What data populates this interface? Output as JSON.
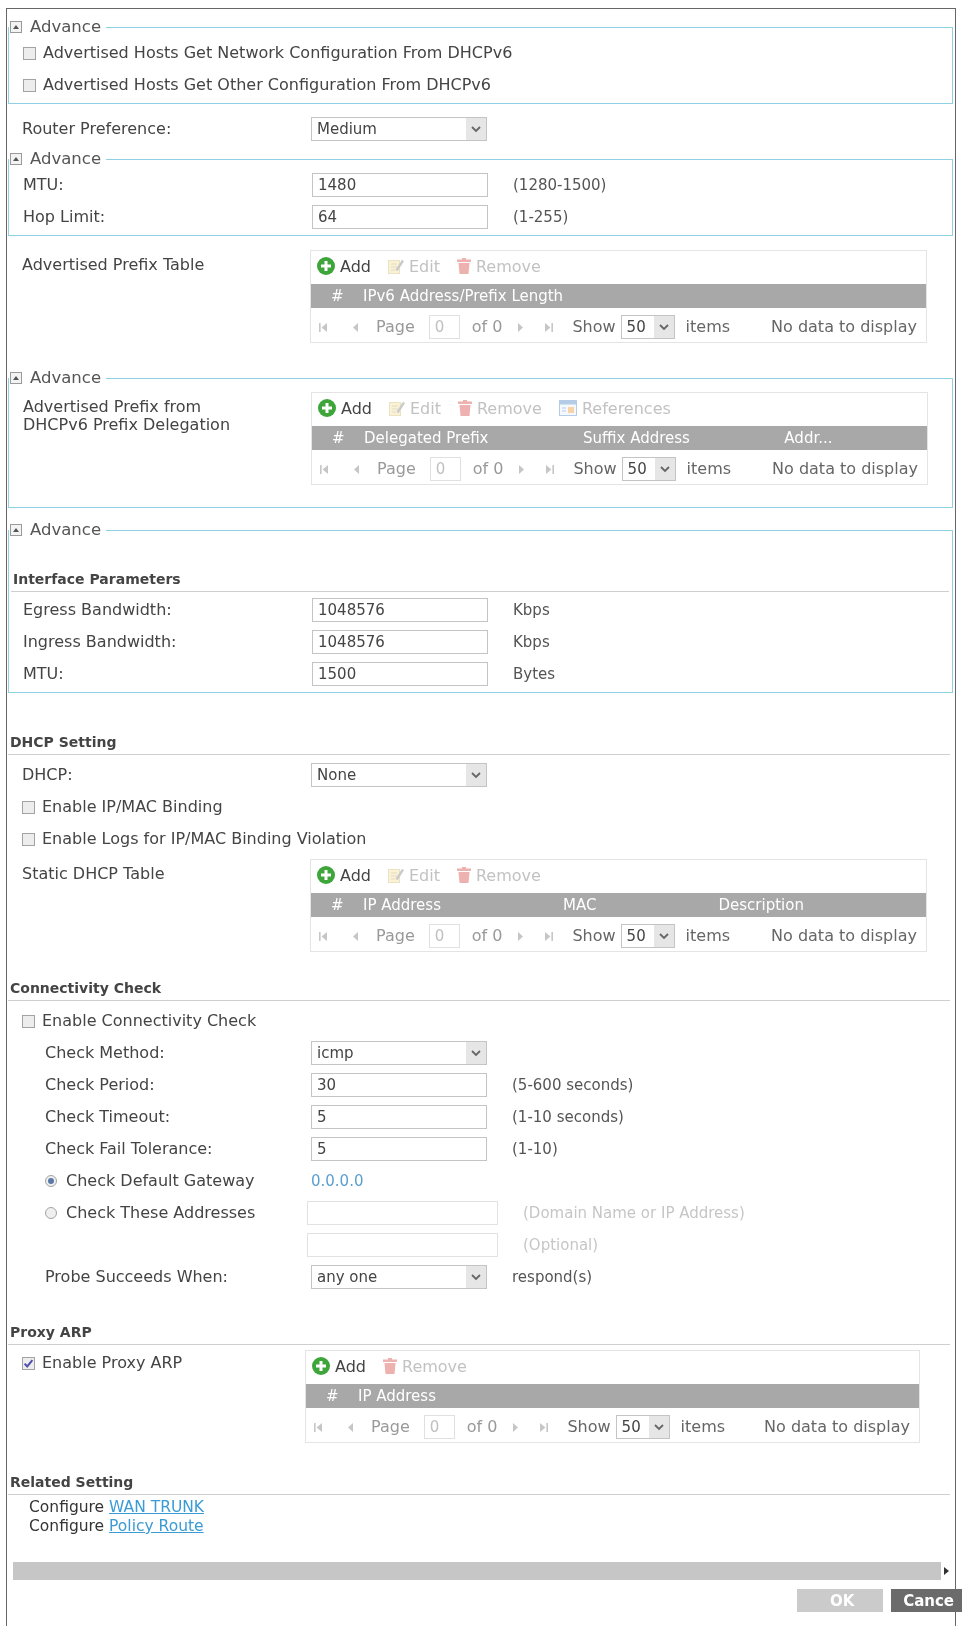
{
  "blocks": [
    {
      "kind": "advance",
      "legend": "Advance",
      "expanded": true,
      "rows": [
        {
          "kind": "checkbox",
          "label": "Advertised Hosts Get Network Configuration From DHCPv6",
          "checked": false
        },
        {
          "kind": "checkbox",
          "label": "Advertised Hosts Get Other Configuration From DHCPv6",
          "checked": false
        }
      ]
    },
    {
      "kind": "select",
      "label": "Router Preference:",
      "value": "Medium"
    },
    {
      "kind": "advance",
      "legend": "Advance",
      "expanded": true,
      "rows": [
        {
          "kind": "input",
          "label": "MTU:",
          "value": "1480",
          "hint": "(1280-1500)",
          "disabled": false
        },
        {
          "kind": "input",
          "label": "Hop Limit:",
          "value": "64",
          "hint": "(1-255)",
          "disabled": false
        }
      ]
    },
    {
      "kind": "table",
      "label": "Advertised Prefix Table",
      "toolbar": [
        {
          "kind": "add",
          "label": "Add",
          "disabled": false
        },
        {
          "kind": "edit",
          "label": "Edit",
          "disabled": true
        },
        {
          "kind": "remove",
          "label": "Remove",
          "disabled": true
        }
      ],
      "columns": [
        "#",
        "IPv6 Address/Prefix Length"
      ],
      "pager": {
        "page_label": "Page",
        "page": "0",
        "total": "of 0",
        "show": "Show",
        "per_page": "50",
        "unit": "items",
        "empty": "No data to display"
      }
    },
    {
      "kind": "advance",
      "legend": "Advance",
      "expanded": true,
      "rows": [
        {
          "kind": "table",
          "label": "Advertised Prefix from DHCPv6 Prefix Delegation",
          "toolbar": [
            {
              "kind": "add",
              "label": "Add",
              "disabled": false
            },
            {
              "kind": "edit",
              "label": "Edit",
              "disabled": true
            },
            {
              "kind": "remove",
              "label": "Remove",
              "disabled": true
            },
            {
              "kind": "references",
              "label": "References",
              "disabled": true
            }
          ],
          "columns": [
            "#",
            "Delegated Prefix",
            "Suffix Address",
            "Addr..."
          ],
          "pager": {
            "page_label": "Page",
            "page": "0",
            "total": "of 0",
            "show": "Show",
            "per_page": "50",
            "unit": "items",
            "empty": "No data to display"
          }
        }
      ]
    },
    {
      "kind": "advance",
      "legend": "Advance",
      "expanded": true,
      "rows": [
        {
          "kind": "heading",
          "text": "Interface Parameters"
        },
        {
          "kind": "input",
          "label": "Egress Bandwidth:",
          "value": "1048576",
          "hint": "Kbps",
          "disabled": false
        },
        {
          "kind": "input",
          "label": "Ingress Bandwidth:",
          "value": "1048576",
          "hint": "Kbps",
          "disabled": false
        },
        {
          "kind": "input",
          "label": "MTU:",
          "value": "1500",
          "hint": "Bytes",
          "disabled": false
        }
      ]
    },
    {
      "kind": "heading",
      "text": "DHCP Setting"
    },
    {
      "kind": "select",
      "label": "DHCP:",
      "value": "None"
    },
    {
      "kind": "checkbox",
      "label": "Enable IP/MAC Binding",
      "checked": false
    },
    {
      "kind": "checkbox",
      "label": "Enable Logs for IP/MAC Binding Violation",
      "checked": false
    },
    {
      "kind": "table",
      "label": "Static DHCP Table",
      "toolbar": [
        {
          "kind": "add",
          "label": "Add",
          "disabled": false
        },
        {
          "kind": "edit",
          "label": "Edit",
          "disabled": true
        },
        {
          "kind": "remove",
          "label": "Remove",
          "disabled": true
        }
      ],
      "columns": [
        "#",
        "IP Address",
        "MAC",
        "Description"
      ],
      "pager": {
        "page_label": "Page",
        "page": "0",
        "total": "of 0",
        "show": "Show",
        "per_page": "50",
        "unit": "items",
        "empty": "No data to display"
      }
    },
    {
      "kind": "heading",
      "text": "Connectivity Check"
    },
    {
      "kind": "checkbox",
      "label": "Enable Connectivity Check",
      "checked": false,
      "children": [
        {
          "kind": "select",
          "label": "Check Method:",
          "value": "icmp"
        },
        {
          "kind": "input",
          "label": "Check Period:",
          "value": "30",
          "hint": "(5-600 seconds)",
          "disabled": false
        },
        {
          "kind": "input",
          "label": "Check Timeout:",
          "value": "5",
          "hint": "(1-10 seconds)",
          "disabled": false
        },
        {
          "kind": "input",
          "label": "Check Fail Tolerance:",
          "value": "5",
          "hint": "(1-10)",
          "disabled": false
        },
        {
          "kind": "radio",
          "label": "Check Default Gateway",
          "selected": true,
          "value": "0.0.0.0"
        },
        {
          "kind": "radio",
          "label": "Check These Addresses",
          "selected": false,
          "field": {
            "disabled": true,
            "hint": "(Domain Name or IP Address)"
          }
        },
        {
          "kind": "input",
          "hint": "(Optional)",
          "disabled": true
        },
        {
          "kind": "select",
          "label": "Probe Succeeds When:",
          "value": "any one",
          "hint": "respond(s)"
        }
      ]
    },
    {
      "kind": "heading",
      "text": "Proxy ARP"
    },
    {
      "kind": "table",
      "checkbox": {
        "label": "Enable Proxy ARP",
        "checked": true
      },
      "toolbar": [
        {
          "kind": "add",
          "label": "Add",
          "disabled": false
        },
        {
          "kind": "remove",
          "label": "Remove",
          "disabled": true
        }
      ],
      "columns": [
        "#",
        "IP Address"
      ],
      "pager": {
        "page_label": "Page",
        "page": "0",
        "total": "of 0",
        "show": "Show",
        "per_page": "50",
        "unit": "items",
        "empty": "No data to display"
      }
    },
    {
      "kind": "heading",
      "text": "Related Setting"
    },
    {
      "kind": "links",
      "items": [
        {
          "text": "Configure",
          "link": "WAN TRUNK"
        },
        {
          "text": "Configure",
          "link": "Policy Route"
        }
      ]
    }
  ],
  "buttons": [
    {
      "label": "OK",
      "disabled": true
    },
    {
      "label": "Cance",
      "disabled": false
    }
  ]
}
